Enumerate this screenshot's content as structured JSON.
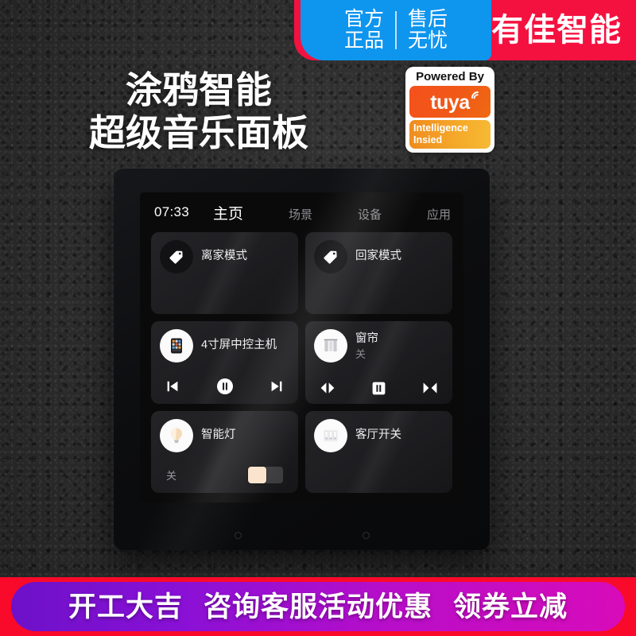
{
  "banners": {
    "blue_left": "官方\n正品",
    "blue_left_line1": "官方",
    "blue_left_line2": "正品",
    "blue_right_line1": "售后",
    "blue_right_line2": "无忧",
    "brand": "有佳智能",
    "blue_color": "#0e95ee",
    "red_color": "#f4113f"
  },
  "headline": {
    "line1": "涂鸦智能",
    "line2": "超级音乐面板"
  },
  "tuya_badge": {
    "powered_by": "Powered By",
    "wordmark": "tuya",
    "subtitle_line1": "Intelligence",
    "subtitle_line2": "Insied",
    "logo_color": "#f0591a"
  },
  "panel": {
    "statusbar": {
      "time": "07:33",
      "tabs": [
        {
          "label": "主页",
          "active": true
        },
        {
          "label": "场景",
          "active": false
        },
        {
          "label": "设备",
          "active": false
        },
        {
          "label": "应用",
          "active": false
        }
      ]
    },
    "cards": [
      {
        "title": "离家模式",
        "sub": "",
        "icon": "tag-icon",
        "style": "dark"
      },
      {
        "title": "回家模式",
        "sub": "",
        "icon": "tag-icon",
        "style": "dark"
      },
      {
        "title": "4寸屏中控主机",
        "sub": "",
        "icon": "control-screen-icon",
        "style": "light",
        "controls": [
          "previous-track-icon",
          "pause-icon",
          "next-track-icon"
        ]
      },
      {
        "title": "窗帘",
        "sub": "关",
        "icon": "curtain-icon",
        "style": "light",
        "controls": [
          "curtain-open-icon",
          "curtain-stop-icon",
          "curtain-close-icon"
        ]
      },
      {
        "title": "智能灯",
        "sub": "",
        "icon": "bulb-icon",
        "style": "light",
        "toggle_state": "关",
        "toggle_on": false,
        "toggle_knob_color": "#fbe3cc"
      },
      {
        "title": "客厅开关",
        "sub": "",
        "icon": "wall-switch-icon",
        "style": "light"
      }
    ]
  },
  "promo": {
    "text1": "开工大吉",
    "text2": "咨询客服活动优惠",
    "text3": "领券立减",
    "band_color": "#fa0a2a"
  }
}
